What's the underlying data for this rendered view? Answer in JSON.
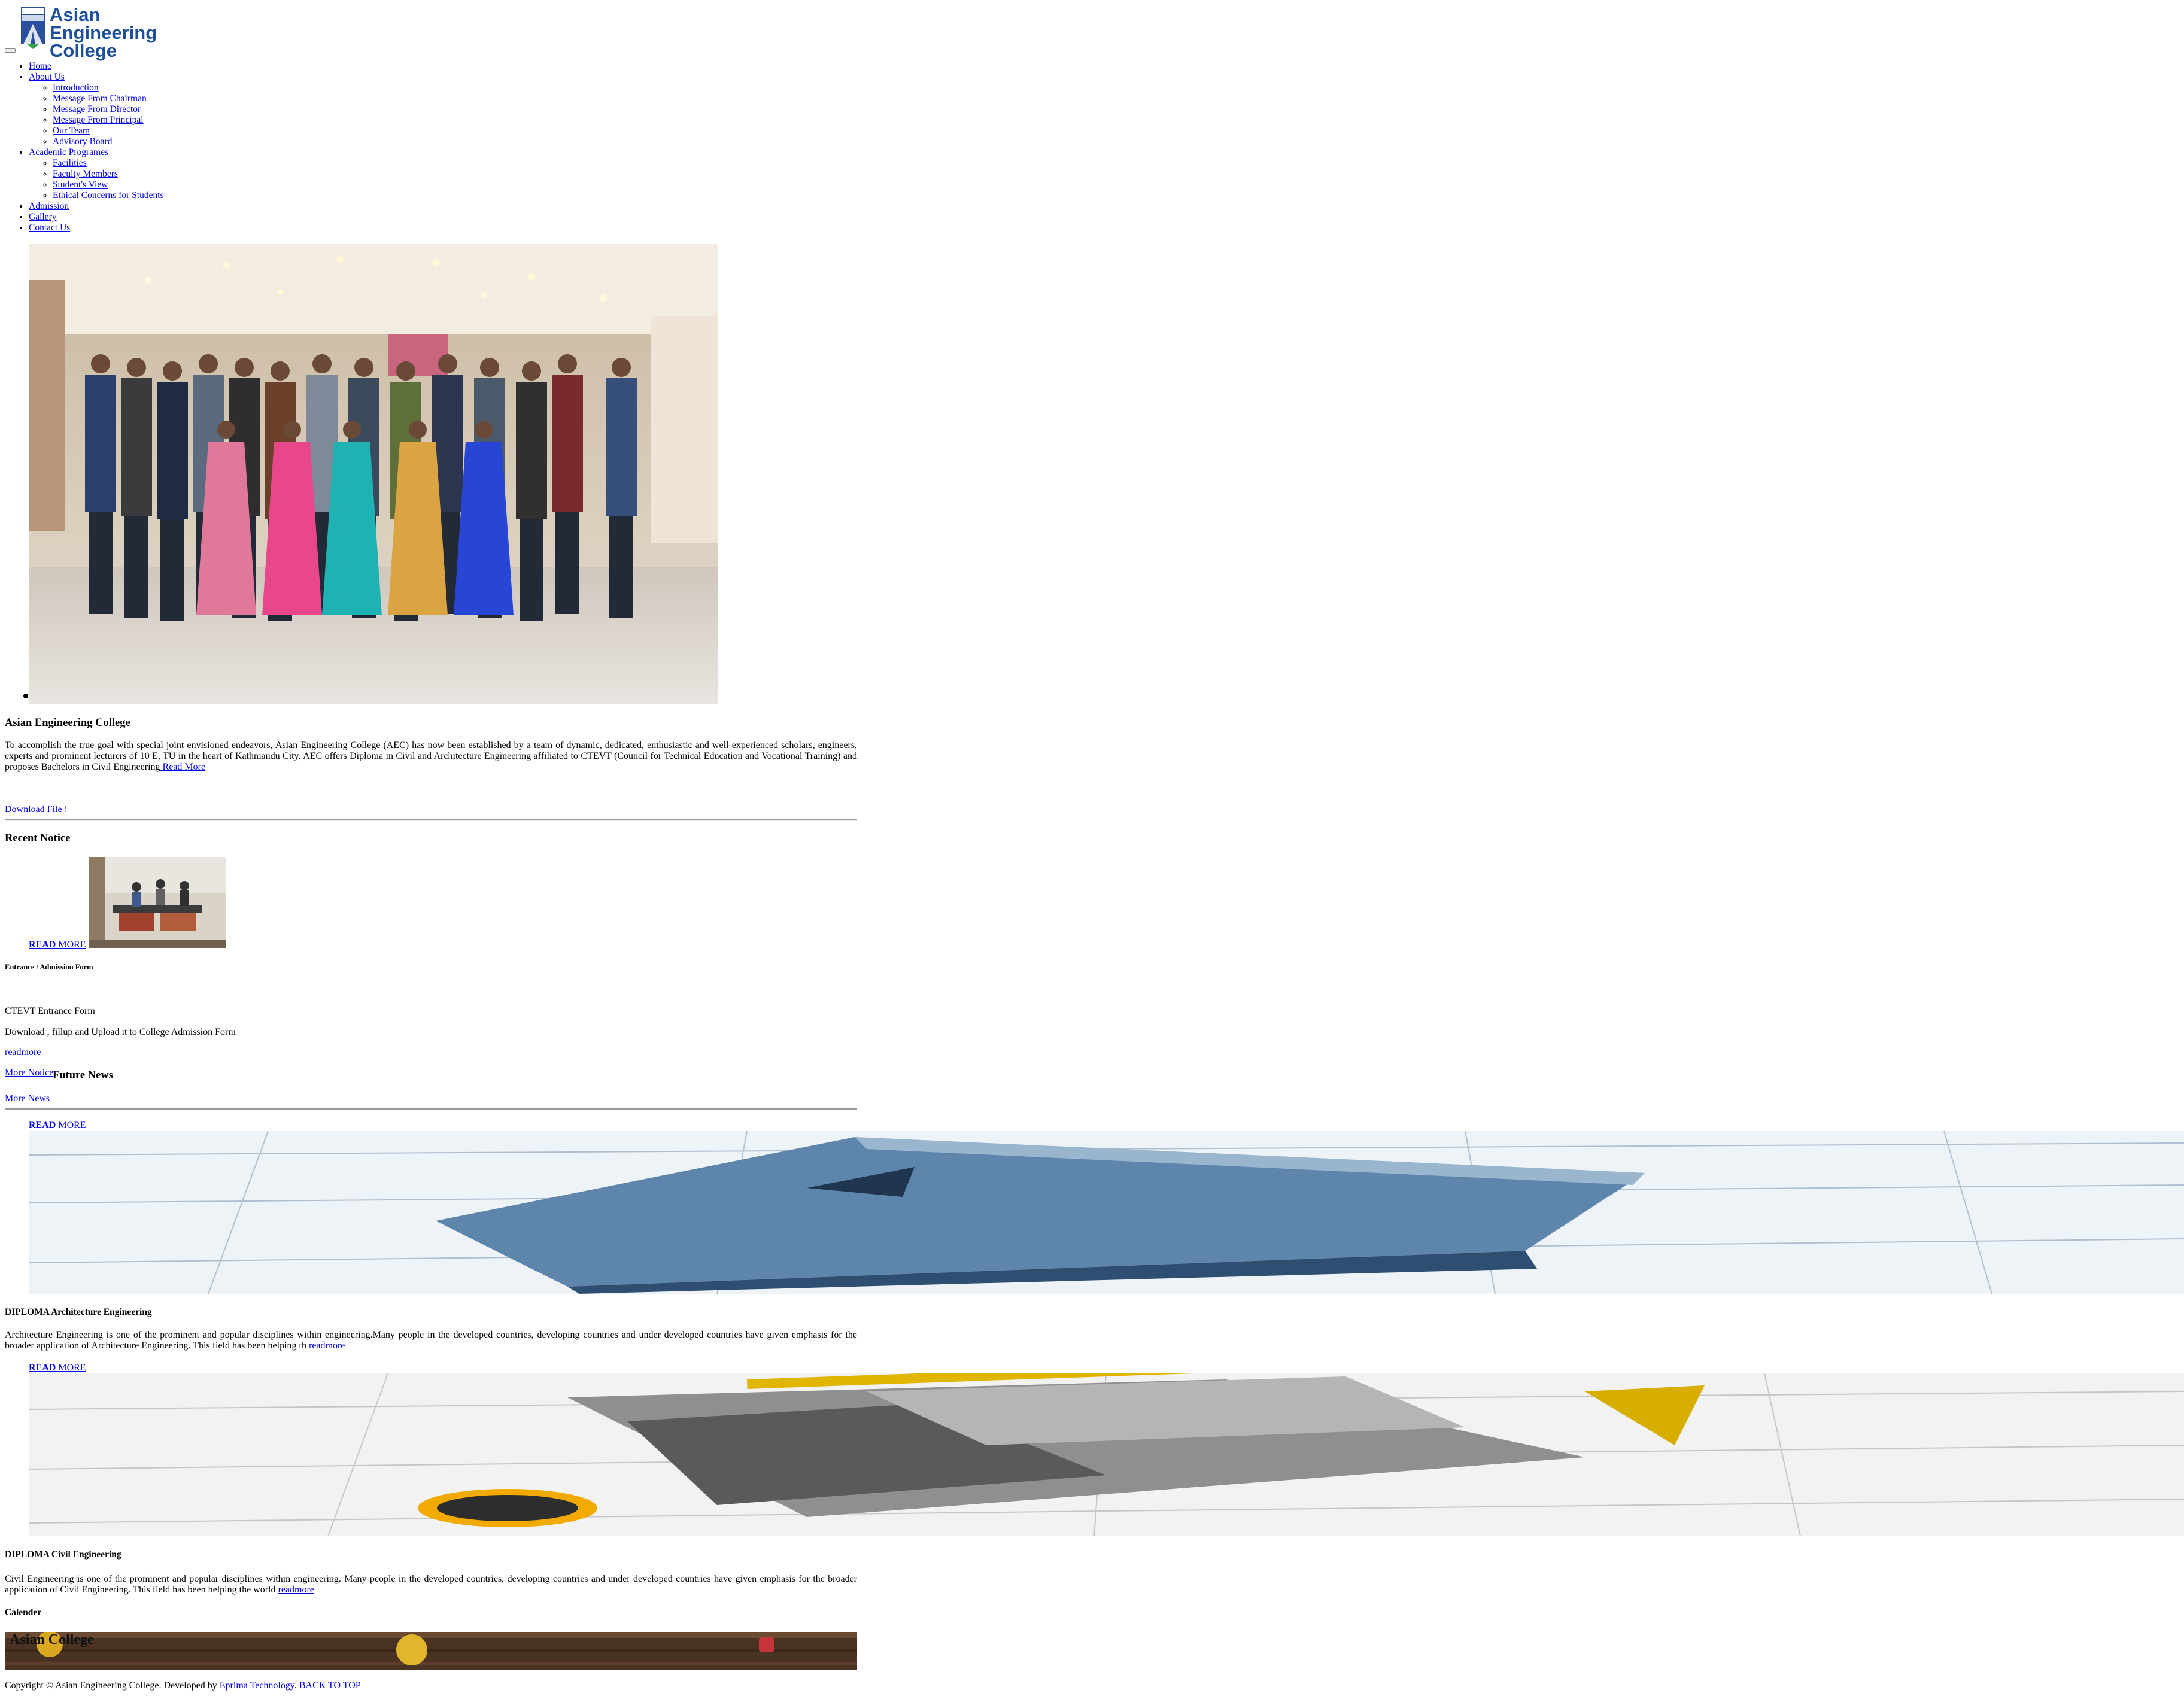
{
  "logo": {
    "name_line1": "Asian Engineering",
    "name_line2": "College"
  },
  "nav": {
    "home": "Home",
    "about": "About Us",
    "about_sub": [
      "Introduction",
      "Message From Chairman",
      "Message From Director",
      "Message From Principal",
      "Our Team",
      "Advisory Board"
    ],
    "academic": "Academic Programes",
    "academic_sub": [
      "Facilities",
      "Faculty Members",
      "Student's View",
      "Ethical Concerns for Students"
    ],
    "admission": "Admission",
    "gallery": "Gallery",
    "contact": "Contact Us"
  },
  "intro": {
    "title": "Asian Engineering College",
    "text": "To accomplish the true goal with special joint envisioned endeavors, Asian Engineering College (AEC) has now been established by a team of dynamic, dedicated, enthusiastic and well-experienced scholars, engineers, experts and prominent lecturers of 10 E, TU in the heart of Kathmandu City. AEC offers Diploma in Civil and Architecture Engineering affiliated to CTEVT (Council for Technical Education and  Vocational Training) and proposes Bachelors in Civil Engineering",
    "read_more": " Read More",
    "download": "Download File !"
  },
  "notice": {
    "title": "Recent Notice",
    "read": "READ",
    "more": " MORE",
    "item_title": "Entrance / Admission Form",
    "line1": "CTEVT Entrance Form",
    "line2": "Download , fillup and Upload it to College Admission Form",
    "readmore": "readmore",
    "more_notice": "More Notice"
  },
  "news": {
    "title": "Future News",
    "more_news": "More News",
    "read": "READ",
    "more": " MORE",
    "items": [
      {
        "title": "DIPLOMA Architecture Engineering",
        "text": "Architecture Engineering is one of the prominent and popular disciplines within engineering.Many people in the developed countries, developing countries and under developed countries have given emphasis for the broader application of Architecture Engineering. This field has been helping th ",
        "readmore": "readmore"
      },
      {
        "title": "DIPLOMA Civil Engineering",
        "text": "Civil Engineering is one of the prominent and popular disciplines within engineering. Many people in the developed countries, developing countries and under developed countries have given emphasis for the broader application of Civil Engineering. This field has been helping the world ",
        "readmore": "readmore"
      }
    ]
  },
  "calendar": {
    "title": "Calender",
    "banner_text": "Asian College"
  },
  "footer": {
    "copyright": "Copyright © Asian Engineering College. Developed by ",
    "dev_link": "Eprima Technology",
    "sep": ". ",
    "back_to_top": "BACK TO TOP"
  }
}
